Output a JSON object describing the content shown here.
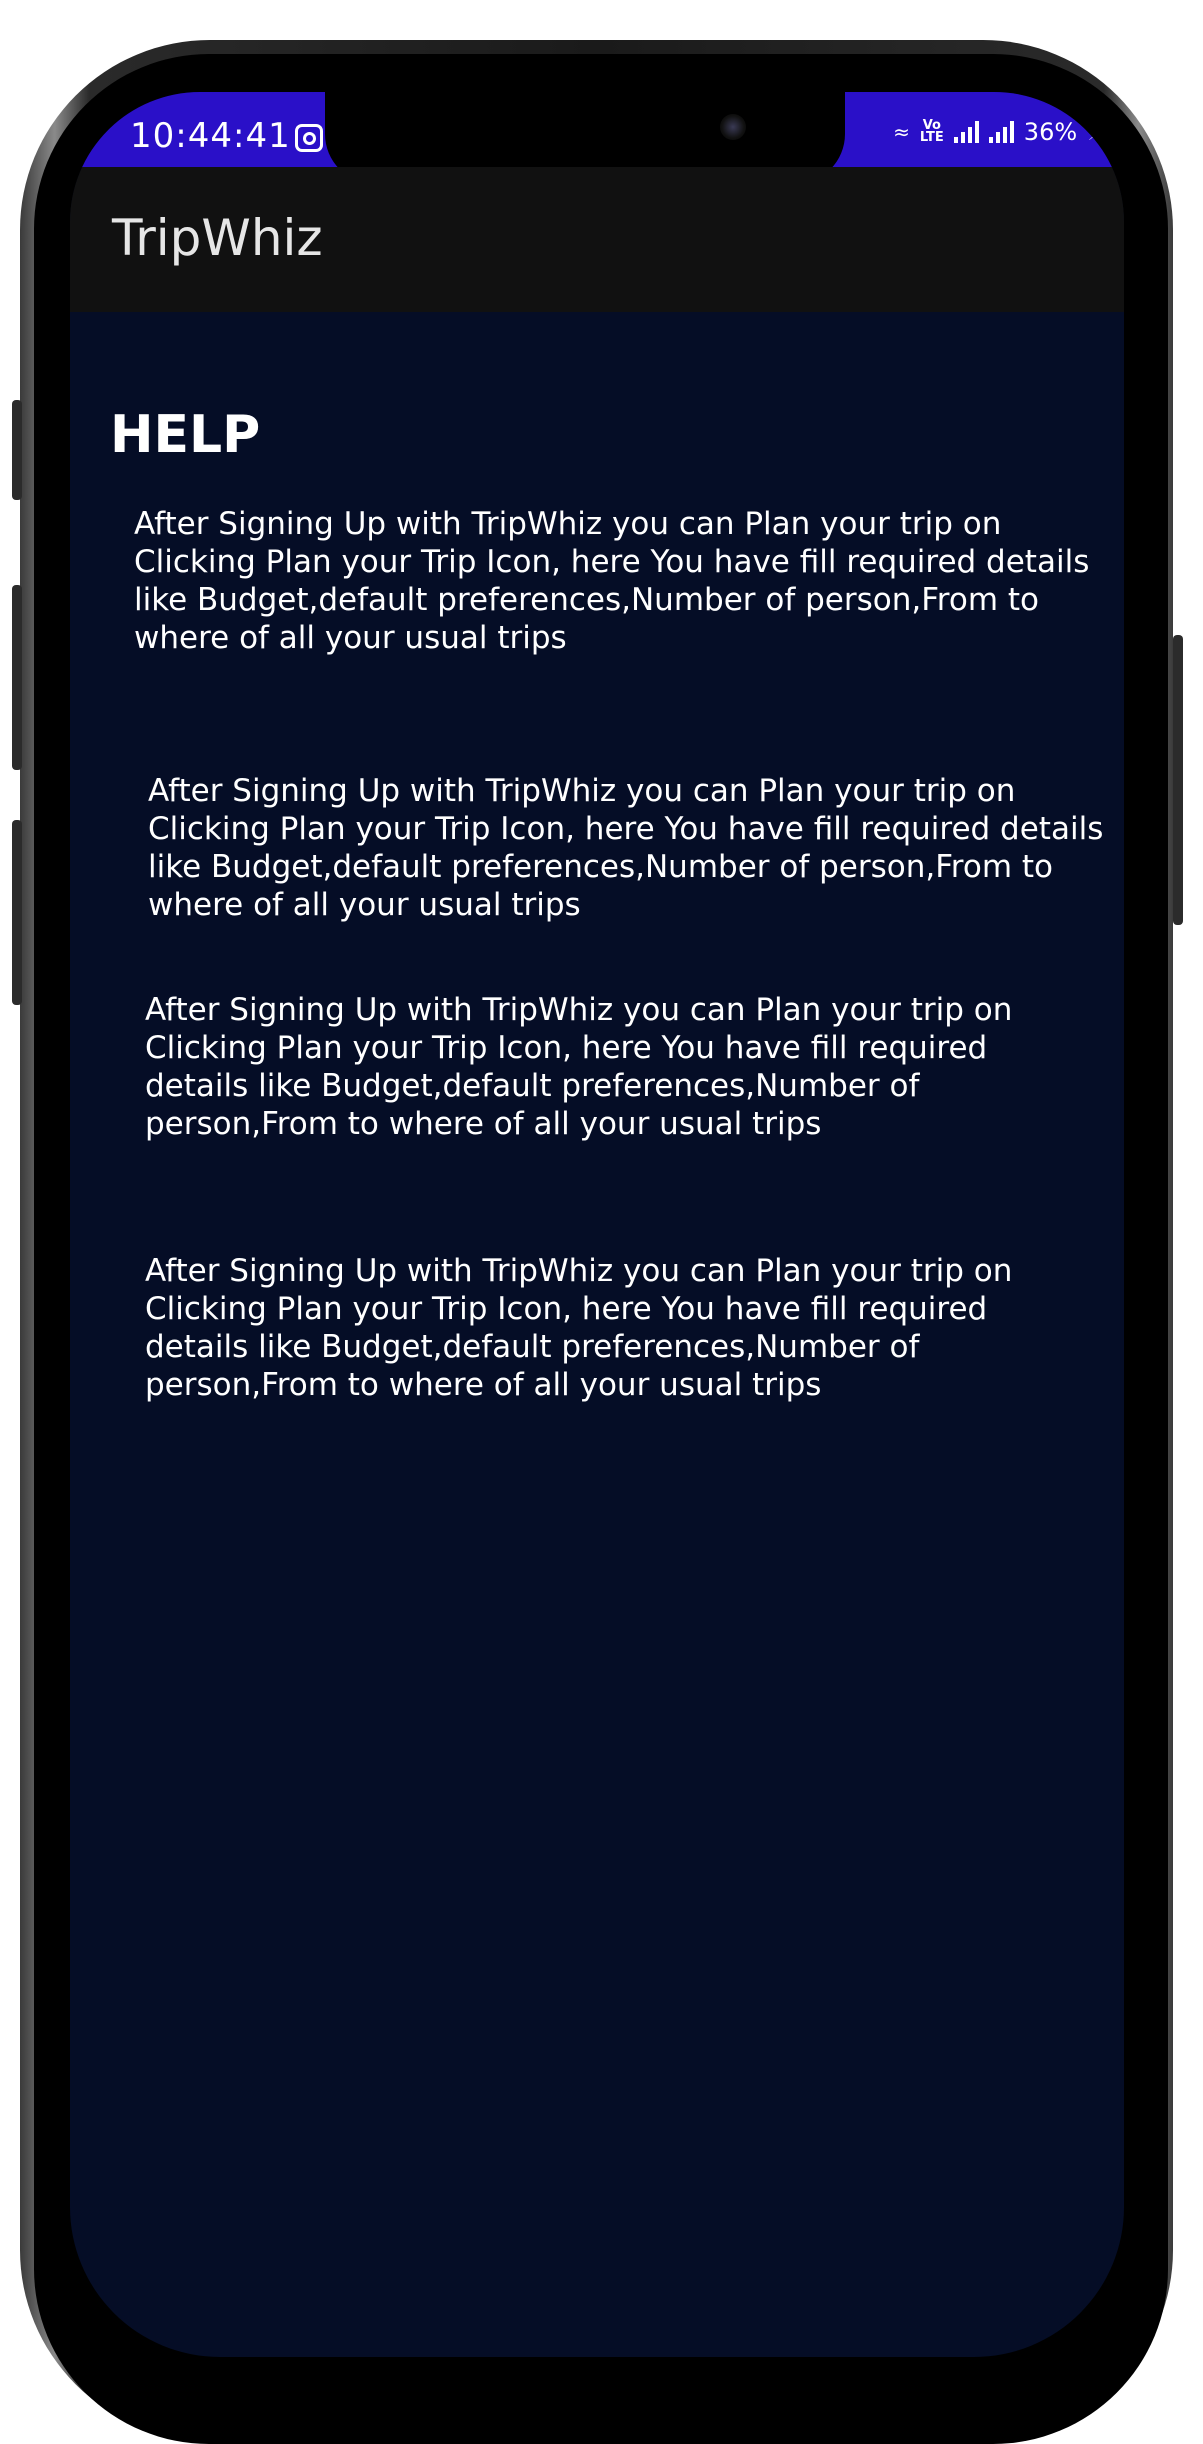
{
  "status_bar": {
    "time": "10:44:41",
    "battery": "36%",
    "network_label": "Vo\nLTE"
  },
  "app_bar": {
    "title": "TripWhiz"
  },
  "help": {
    "heading": "HELP",
    "paragraphs": [
      "After Signing Up with TripWhiz you can Plan your trip on Clicking Plan your Trip Icon, here You have fill required details like Budget,default preferences,Number of person,From to where of all your usual trips",
      "After Signing Up with TripWhiz you can Plan your trip on Clicking Plan your Trip Icon, here You have fill required details like Budget,default preferences,Number of person,From to where of all your usual trips",
      "After Signing Up with TripWhiz you can Plan your trip on Clicking Plan your Trip Icon, here You have fill required details like Budget,default preferences,Number of person,From to where of all your usual trips",
      "After Signing Up with TripWhiz you can Plan your trip on Clicking Plan your Trip Icon, here You have fill required details like Budget,default preferences,Number of person,From to where of all your usual trips"
    ]
  },
  "icons": {
    "notification": "instagram-icon",
    "signal": "signal-strength-icon",
    "battery": "battery-charging-icon"
  },
  "colors": {
    "status_bar": "#2a10c8",
    "app_bar": "#111111",
    "background": "#050d26",
    "text": "#ffffff"
  }
}
